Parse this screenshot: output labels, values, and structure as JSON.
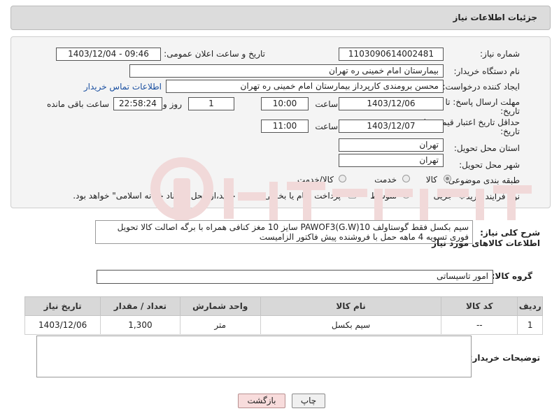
{
  "header": {
    "title": "جزئیات اطلاعات نیاز"
  },
  "form": {
    "need_number_label": "شماره نیاز:",
    "need_number": "1103090614002481",
    "announce_label": "تاریخ و ساعت اعلان عمومی:",
    "announce_value": "1403/12/04 - 09:46",
    "buyer_label": "نام دستگاه خریدار:",
    "buyer_value": "بیمارستان امام خمینی ره  تهران",
    "creator_label": "ایجاد کننده درخواست:",
    "creator_value": "محسن برومندی کارپرداز بیمارستان امام خمینی ره  تهران",
    "contact_link": "اطلاعات تماس خریدار",
    "reply_deadline_label_1": "مهلت ارسال پاسخ: تا",
    "reply_deadline_label_2": "تاریخ:",
    "reply_date": "1403/12/06",
    "time_label": "ساعت",
    "reply_time": "10:00",
    "days_value": "1",
    "days_label": "روز و",
    "remaining_value": "22:58:24",
    "remaining_label": "ساعت باقی مانده",
    "price_validity_label_1": "حداقل تاریخ اعتبار قیمت: تا",
    "price_validity_label_2": "تاریخ:",
    "validity_date": "1403/12/07",
    "validity_time": "11:00",
    "province_label": "استان محل تحویل:",
    "province_value": "تهران",
    "city_label": "شهر محل تحویل:",
    "city_value": "تهران",
    "category_label": "طبقه بندی موضوعی:",
    "category_options": [
      "کالا",
      "خدمت",
      "کالا/خدمت"
    ],
    "process_label": "نوع فرآیند خرید :",
    "process_options": [
      "جزیی",
      "متوسط"
    ],
    "payment_note": "پرداخت تمام یا بخشی از مبلغ خرید،از محل \"اسناد خزانه اسلامی\" خواهد بود."
  },
  "description": {
    "label": "شرح کلی نیاز:",
    "text": "سیم بکسل فقط  گوستاولف PAWOF3(G.W)10 سایز 10 مغز کنافی همراه با برگه اصالت کالا تحویل فوری تسویه 4 ماهه حمل با فروشنده پیش فاکتور الزامیست"
  },
  "goods": {
    "section_title": "اطلاعات کالاهای مورد نیاز",
    "group_label": "گروه کالا:",
    "group_value": "امور تاسیساتی",
    "columns": [
      "ردیف",
      "کد کالا",
      "نام کالا",
      "واحد شمارش",
      "تعداد / مقدار",
      "تاریخ نیاز"
    ],
    "rows": [
      [
        "1",
        "--",
        "سیم بکسل",
        "متر",
        "1,300",
        "1403/12/06"
      ]
    ]
  },
  "buyer_notes": {
    "label": "توضیحات خریدار:",
    "value": ""
  },
  "buttons": {
    "print": "چاپ",
    "back": "بازگشت"
  },
  "colors": {
    "link": "#1a4fa0",
    "back_button_bg": "#f8dcdc",
    "watermark": "#f1d9d9"
  }
}
